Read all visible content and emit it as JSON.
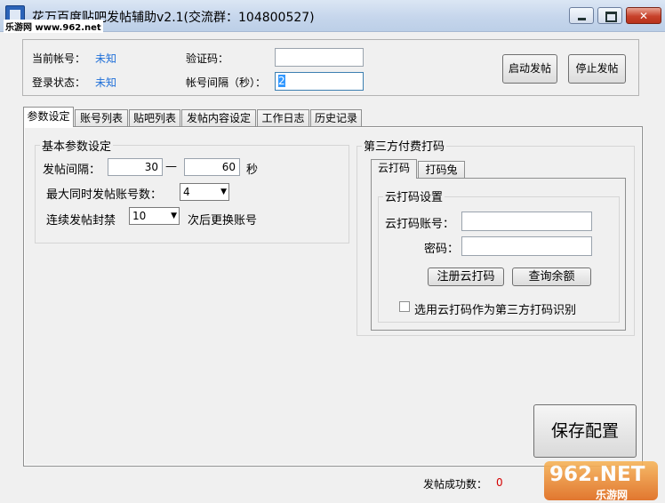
{
  "window": {
    "title": "花万百度贴吧发帖辅助v2.1(交流群：104800527)",
    "site_watermark": "乐游网 www.962.net"
  },
  "status": {
    "account_label": "当前帐号：",
    "account_value": "未知",
    "login_label": "登录状态：",
    "login_value": "未知",
    "captcha_label": "验证码：",
    "captcha_value": "",
    "interval_label": "帐号间隔（秒）：",
    "interval_value": "2",
    "start_button": "启动发帖",
    "stop_button": "停止发帖"
  },
  "tabs": [
    {
      "label": "参数设定",
      "active": true
    },
    {
      "label": "账号列表",
      "active": false
    },
    {
      "label": "贴吧列表",
      "active": false
    },
    {
      "label": "发帖内容设定",
      "active": false
    },
    {
      "label": "工作日志",
      "active": false
    },
    {
      "label": "历史记录",
      "active": false
    }
  ],
  "basic": {
    "group_title": "基本参数设定",
    "post_interval_label": "发帖间隔：",
    "interval_min": "30",
    "dash": "—",
    "interval_max": "60",
    "unit_seconds": "秒",
    "max_accounts_label": "最大同时发帖账号数：",
    "max_accounts_value": "4",
    "ban_label": "连续发帖封禁",
    "ban_value": "10",
    "ban_suffix": "次后更换账号"
  },
  "third_party": {
    "group_title": "第三方付费打码",
    "subtabs": [
      {
        "label": "云打码",
        "active": true
      },
      {
        "label": "打码兔",
        "active": false
      }
    ],
    "settings_title": "云打码设置",
    "account_label": "云打码账号：",
    "account_value": "",
    "password_label": "密码：",
    "password_value": "",
    "register_button": "注册云打码",
    "balance_button": "查询余额",
    "use_checkbox_label": "选用云打码作为第三方打码识别",
    "use_checkbox_checked": false
  },
  "footer": {
    "save_button": "保存配置",
    "success_label": "发帖成功数：",
    "success_value": "0",
    "watermark_big": "962.NET",
    "watermark_small": "乐游网"
  },
  "colors": {
    "accent_blue": "#1f6fd8",
    "count_red": "#d40000"
  }
}
